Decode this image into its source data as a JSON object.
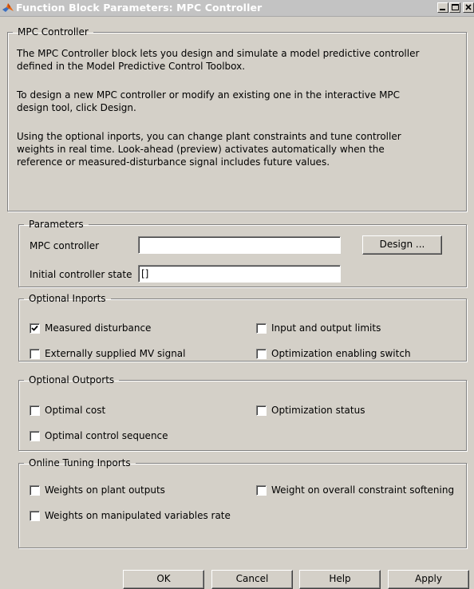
{
  "window": {
    "title": "Function Block Parameters: MPC Controller",
    "controls": [
      "minimize",
      "maximize",
      "close"
    ]
  },
  "description": {
    "legend": "MPC Controller",
    "paragraphs": [
      [
        "The MPC Controller block lets you design and simulate a model predictive controller",
        "defined in the Model Predictive Control Toolbox."
      ],
      [
        "To design a new MPC controller or modify an existing one in the interactive MPC",
        "design tool, click Design."
      ],
      [
        "Using the optional inports, you can change plant constraints and tune controller",
        "weights in real time.  Look-ahead (preview) activates automatically when the",
        "reference or measured-disturbance signal includes future values."
      ]
    ]
  },
  "parameters": {
    "legend": "Parameters",
    "mpc_controller_label": "MPC controller",
    "mpc_controller_value": "",
    "design_button": "Design ...",
    "initial_state_label": "Initial controller state",
    "initial_state_value": "[]"
  },
  "optional_inports": {
    "legend": "Optional Inports",
    "measured_disturbance": {
      "label": "Measured disturbance",
      "checked": true
    },
    "io_limits": {
      "label": "Input and output limits",
      "checked": false
    },
    "external_mv": {
      "label": "Externally supplied MV signal",
      "checked": false
    },
    "opt_switch": {
      "label": "Optimization enabling switch",
      "checked": false
    }
  },
  "optional_outports": {
    "legend": "Optional Outports",
    "optimal_cost": {
      "label": "Optimal cost",
      "checked": false
    },
    "opt_status": {
      "label": "Optimization status",
      "checked": false
    },
    "control_sequence": {
      "label": "Optimal control sequence",
      "checked": false
    }
  },
  "online_tuning": {
    "legend": "Online Tuning Inports",
    "plant_output_weights": {
      "label": "Weights on plant outputs",
      "checked": false
    },
    "constraint_softening": {
      "label": "Weight on overall constraint softening",
      "checked": false
    },
    "mv_rate_weights": {
      "label": "Weights on manipulated variables rate",
      "checked": false
    }
  },
  "buttons": {
    "ok": "OK",
    "cancel": "Cancel",
    "help": "Help",
    "apply": "Apply"
  }
}
